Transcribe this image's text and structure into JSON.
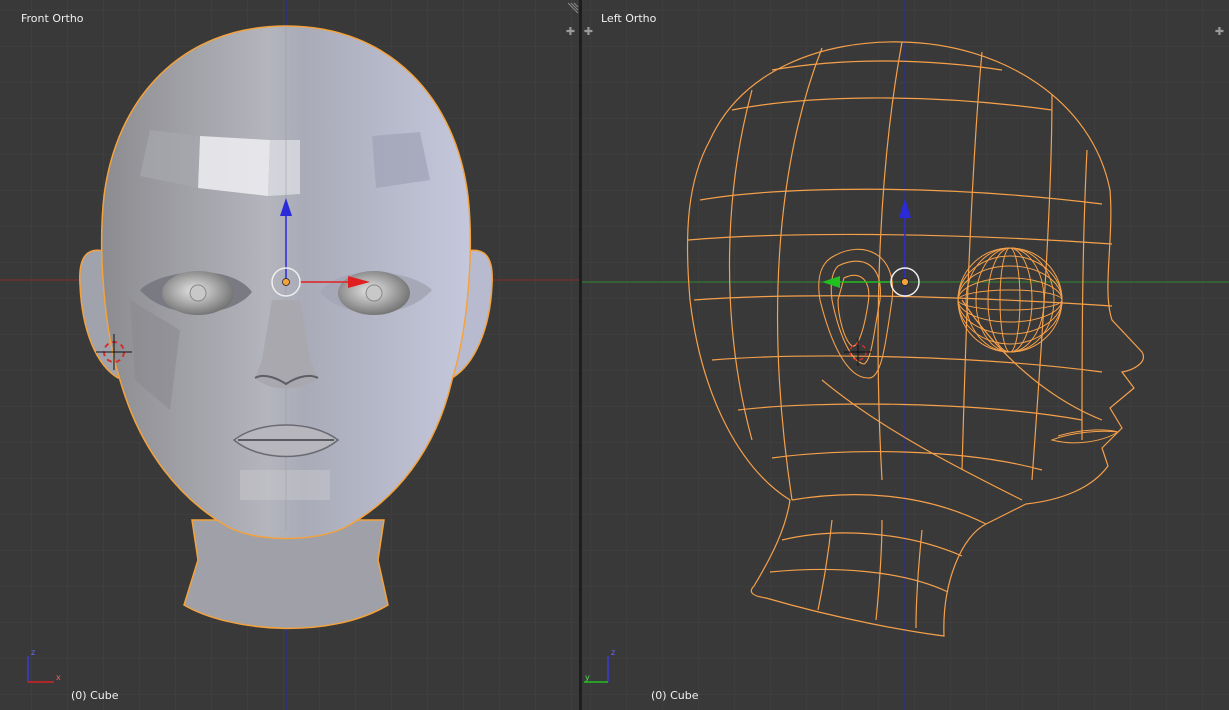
{
  "viewports": [
    {
      "title": "Front Ortho",
      "status": "(0) Cube",
      "axes": [
        "z",
        "x"
      ]
    },
    {
      "title": "Left Ortho",
      "status": "(0) Cube",
      "axes": [
        "z",
        "y"
      ]
    }
  ],
  "icons": {
    "area_split": "plus-icon",
    "area_corner": "hatch-icon"
  },
  "colors": {
    "background": "#393939",
    "grid_line": "#444444",
    "grid_line_major": "#4a4a4a",
    "axis_x": "#b02828",
    "axis_y": "#2e9a2e",
    "axis_z": "#2a2ab8",
    "selection_outline": "#f4a23c",
    "wire": "#f5a04a",
    "mesh_shade": "#b9bbc6"
  }
}
